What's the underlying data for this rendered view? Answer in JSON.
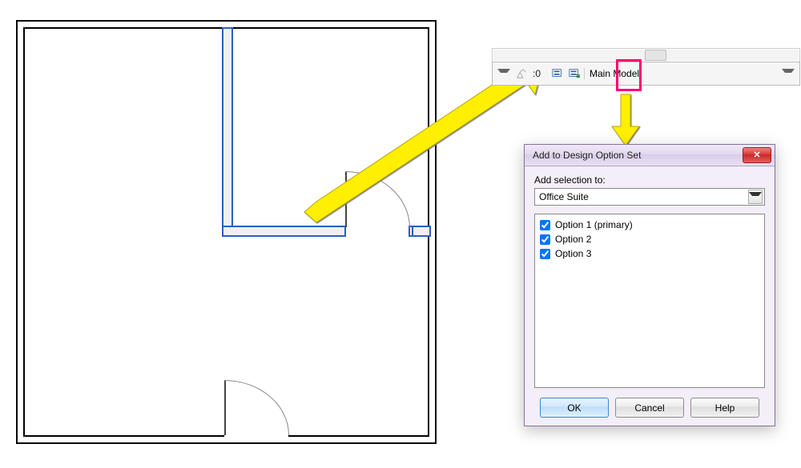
{
  "toolbar": {
    "filter_count": ":0",
    "active_option": "Main Model"
  },
  "dialog": {
    "title": "Add to Design Option Set",
    "section_label": "Add selection to:",
    "combo_value": "Office Suite",
    "options": [
      {
        "label": "Option 1 (primary)",
        "checked": true
      },
      {
        "label": "Option 2",
        "checked": true
      },
      {
        "label": "Option 3",
        "checked": true
      }
    ],
    "buttons": {
      "ok": "OK",
      "cancel": "Cancel",
      "help": "Help"
    }
  }
}
